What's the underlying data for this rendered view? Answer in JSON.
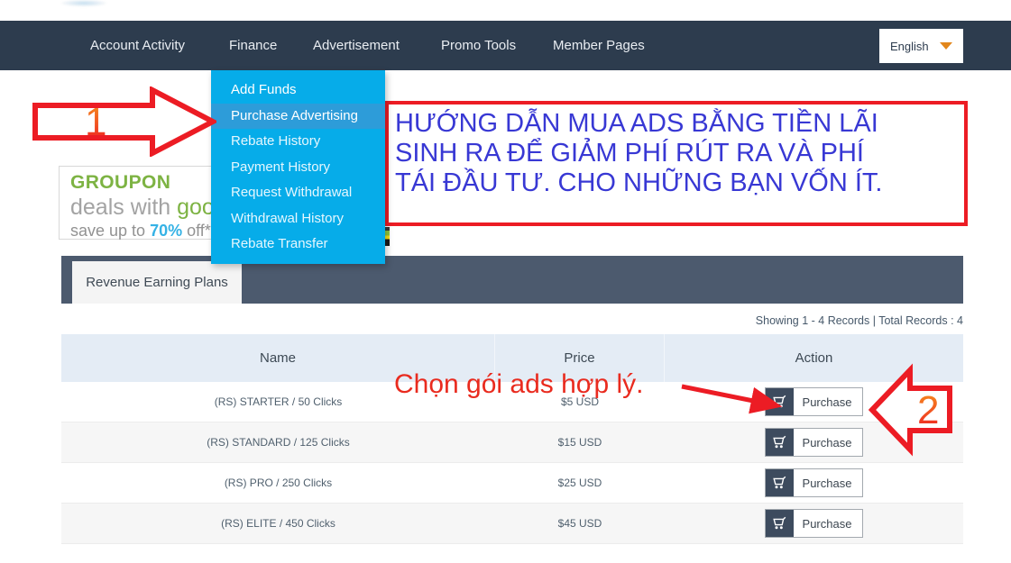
{
  "nav": {
    "items": [
      "Account Activity",
      "Finance",
      "Advertisement",
      "Promo Tools",
      "Member Pages"
    ],
    "language": "English"
  },
  "finance_menu": {
    "items": [
      "Add Funds",
      "Purchase Advertising",
      "Rebate History",
      "Payment History",
      "Request Withdrawal",
      "Withdrawal History",
      "Rebate Transfer"
    ],
    "active_item": "Purchase Advertising"
  },
  "annotations": {
    "step1": "1",
    "step2": "2",
    "info_lines": [
      "HƯỚNG DẪN MUA ADS BẰNG TIỀN LÃI",
      "SINH RA ĐỂ GIẢM PHÍ RÚT RA VÀ PHÍ",
      "TÁI ĐẦU TƯ. CHO NHỮNG BẠN VỐN ÍT."
    ],
    "choose_note": "Chọn gói ads hợp lý."
  },
  "ad": {
    "brand": "GROUPON",
    "line1_prefix": "deals with ",
    "line1_highlight": "goo",
    "line2_prefix": "save up to ",
    "line2_percent": "70%",
    "line2_suffix": " off*"
  },
  "tabs": {
    "active": "Revenue Earning Plans"
  },
  "records_info": "Showing 1 - 4 Records | Total Records : 4",
  "table": {
    "columns": [
      "Name",
      "Price",
      "Action"
    ],
    "purchase_label": "Purchase",
    "rows": [
      {
        "name": "(RS) STARTER / 50 Clicks",
        "price": "$5 USD"
      },
      {
        "name": "(RS) STANDARD / 125 Clicks",
        "price": "$15 USD"
      },
      {
        "name": "(RS) PRO / 250 Clicks",
        "price": "$25 USD"
      },
      {
        "name": "(RS) ELITE / 450 Clicks",
        "price": "$45 USD"
      }
    ]
  },
  "colors": {
    "nav_bg": "#2d3c4e",
    "menu_bg": "#06ace9",
    "menu_highlight": "#2d9cd9",
    "annotation_red": "#ec1c24",
    "instruction_blue": "#3838d4",
    "groupon_green": "#7db343",
    "percent_blue": "#35b2e5",
    "tab_bar_bg": "#4c5a6e",
    "table_header_bg": "#e4ecf5"
  }
}
